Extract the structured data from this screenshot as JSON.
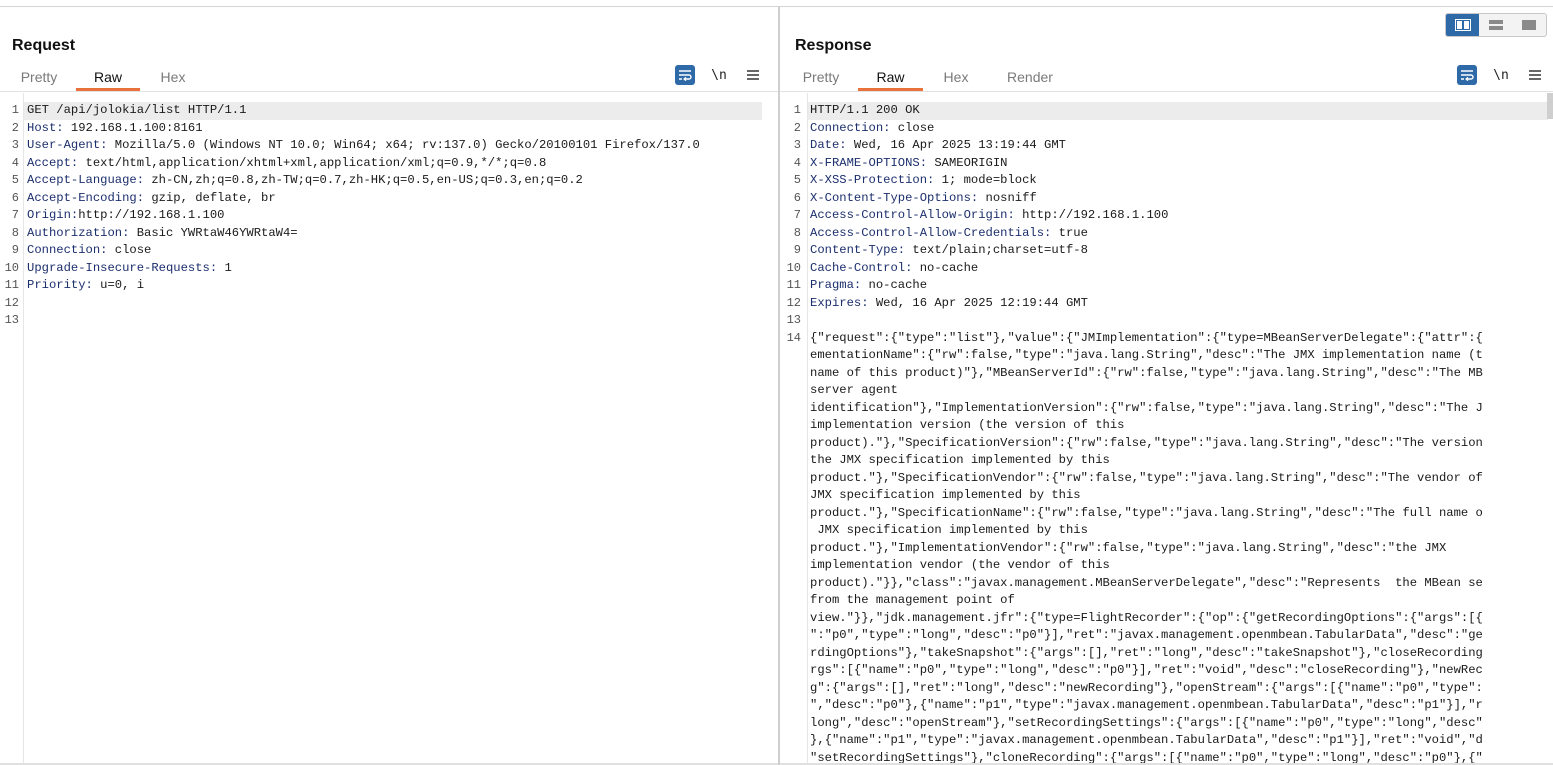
{
  "request": {
    "title": "Request",
    "tabs": [
      "Pretty",
      "Raw",
      "Hex"
    ],
    "active_tab": "Raw",
    "lines": [
      {
        "n": "1",
        "key": "",
        "value": "GET /api/jolokia/list HTTP/1.1"
      },
      {
        "n": "2",
        "key": "Host:",
        "value": " 192.168.1.100:8161"
      },
      {
        "n": "3",
        "key": "User-Agent:",
        "value": " Mozilla/5.0 (Windows NT 10.0; Win64; x64; rv:137.0) Gecko/20100101 Firefox/137.0"
      },
      {
        "n": "4",
        "key": "Accept:",
        "value": " text/html,application/xhtml+xml,application/xml;q=0.9,*/*;q=0.8"
      },
      {
        "n": "5",
        "key": "Accept-Language:",
        "value": " zh-CN,zh;q=0.8,zh-TW;q=0.7,zh-HK;q=0.5,en-US;q=0.3,en;q=0.2"
      },
      {
        "n": "6",
        "key": "Accept-Encoding:",
        "value": " gzip, deflate, br"
      },
      {
        "n": "7",
        "key": "Origin:",
        "value": "http://192.168.1.100"
      },
      {
        "n": "8",
        "key": "Authorization:",
        "value": " Basic YWRtaW46YWRtaW4="
      },
      {
        "n": "9",
        "key": "Connection:",
        "value": " close"
      },
      {
        "n": "10",
        "key": "Upgrade-Insecure-Requests:",
        "value": " 1"
      },
      {
        "n": "11",
        "key": "Priority:",
        "value": " u=0, i"
      },
      {
        "n": "12",
        "key": "",
        "value": ""
      },
      {
        "n": "13",
        "key": "",
        "value": ""
      }
    ]
  },
  "response": {
    "title": "Response",
    "tabs": [
      "Pretty",
      "Raw",
      "Hex",
      "Render"
    ],
    "active_tab": "Raw",
    "lines": [
      {
        "n": "1",
        "key": "",
        "value": "HTTP/1.1 200 OK"
      },
      {
        "n": "2",
        "key": "Connection:",
        "value": " close"
      },
      {
        "n": "3",
        "key": "Date:",
        "value": " Wed, 16 Apr 2025 13:19:44 GMT"
      },
      {
        "n": "4",
        "key": "X-FRAME-OPTIONS:",
        "value": " SAMEORIGIN"
      },
      {
        "n": "5",
        "key": "X-XSS-Protection:",
        "value": " 1; mode=block"
      },
      {
        "n": "6",
        "key": "X-Content-Type-Options:",
        "value": " nosniff"
      },
      {
        "n": "7",
        "key": "Access-Control-Allow-Origin:",
        "value": " http://192.168.1.100"
      },
      {
        "n": "8",
        "key": "Access-Control-Allow-Credentials:",
        "value": " true"
      },
      {
        "n": "9",
        "key": "Content-Type:",
        "value": " text/plain;charset=utf-8"
      },
      {
        "n": "10",
        "key": "Cache-Control:",
        "value": " no-cache"
      },
      {
        "n": "11",
        "key": "Pragma:",
        "value": " no-cache"
      },
      {
        "n": "12",
        "key": "Expires:",
        "value": " Wed, 16 Apr 2025 12:19:44 GMT"
      },
      {
        "n": "13",
        "key": "",
        "value": ""
      },
      {
        "n": "14",
        "key": "",
        "value": ""
      }
    ],
    "body_lines": [
      "{\"request\":{\"type\":\"list\"},\"value\":{\"JMImplementation\":{\"type=MBeanServerDelegate\":{\"attr\":{",
      "ementationName\":{\"rw\":false,\"type\":\"java.lang.String\",\"desc\":\"The JMX implementation name (t",
      "name of this product)\"},\"MBeanServerId\":{\"rw\":false,\"type\":\"java.lang.String\",\"desc\":\"The MB",
      "server agent",
      "identification\"},\"ImplementationVersion\":{\"rw\":false,\"type\":\"java.lang.String\",\"desc\":\"The J",
      "implementation version (the version of this",
      "product).\"},\"SpecificationVersion\":{\"rw\":false,\"type\":\"java.lang.String\",\"desc\":\"The version",
      "the JMX specification implemented by this",
      "product.\"},\"SpecificationVendor\":{\"rw\":false,\"type\":\"java.lang.String\",\"desc\":\"The vendor of",
      "JMX specification implemented by this",
      "product.\"},\"SpecificationName\":{\"rw\":false,\"type\":\"java.lang.String\",\"desc\":\"The full name o",
      " JMX specification implemented by this",
      "product.\"},\"ImplementationVendor\":{\"rw\":false,\"type\":\"java.lang.String\",\"desc\":\"the JMX",
      "implementation vendor (the vendor of this",
      "product).\"}},\"class\":\"javax.management.MBeanServerDelegate\",\"desc\":\"Represents  the MBean se",
      "from the management point of",
      "view.\"}},\"jdk.management.jfr\":{\"type=FlightRecorder\":{\"op\":{\"getRecordingOptions\":{\"args\":[{",
      "\":\"p0\",\"type\":\"long\",\"desc\":\"p0\"}],\"ret\":\"javax.management.openmbean.TabularData\",\"desc\":\"ge",
      "rdingOptions\"},\"takeSnapshot\":{\"args\":[],\"ret\":\"long\",\"desc\":\"takeSnapshot\"},\"closeRecording",
      "rgs\":[{\"name\":\"p0\",\"type\":\"long\",\"desc\":\"p0\"}],\"ret\":\"void\",\"desc\":\"closeRecording\"},\"newRec",
      "g\":{\"args\":[],\"ret\":\"long\",\"desc\":\"newRecording\"},\"openStream\":{\"args\":[{\"name\":\"p0\",\"type\":",
      "\",\"desc\":\"p0\"},{\"name\":\"p1\",\"type\":\"javax.management.openmbean.TabularData\",\"desc\":\"p1\"}],\"r",
      "long\",\"desc\":\"openStream\"},\"setRecordingSettings\":{\"args\":[{\"name\":\"p0\",\"type\":\"long\",\"desc\"",
      "},{\"name\":\"p1\",\"type\":\"javax.management.openmbean.TabularData\",\"desc\":\"p1\"}],\"ret\":\"void\",\"d",
      "\"setRecordingSettings\"},\"cloneRecording\":{\"args\":[{\"name\":\"p0\",\"type\":\"long\",\"desc\":\"p0\"},{\""
    ]
  },
  "toolbar": {
    "newline_label": "\\n",
    "icons": [
      "wrap-lines-icon",
      "newline-icon",
      "menu-icon"
    ]
  },
  "colors": {
    "accent": "#e8713c",
    "header_key": "#1c2f6e",
    "toggle_active": "#2e6aa8"
  }
}
